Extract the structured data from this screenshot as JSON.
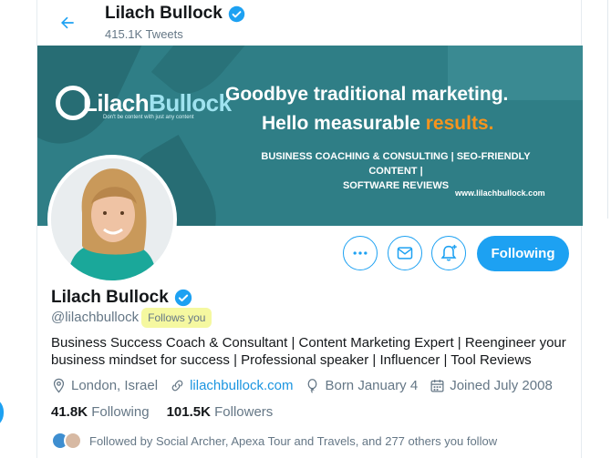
{
  "header": {
    "title": "Lilach Bullock",
    "subtitle": "415.1K Tweets"
  },
  "banner": {
    "logo_part1": "Lilach",
    "logo_part2": "Bullock",
    "logo_tagline": "Don't be content with just any content",
    "headline_line1": "Goodbye traditional marketing.",
    "headline_line2_prefix": "Hello measurable ",
    "headline_line2_accent": "results.",
    "services_line1": "BUSINESS COACHING & CONSULTING | SEO-FRIENDLY CONTENT |",
    "services_line2": "SOFTWARE REVIEWS",
    "url": "www.lilachbullock.com"
  },
  "actions": {
    "following_label": "Following"
  },
  "profile": {
    "name": "Lilach Bullock",
    "handle": "@lilachbullock",
    "follows_you": "Follows you",
    "bio_line1": "Business Success Coach & Consultant | Content Marketing Expert | Reengineer your",
    "bio_line2": "business mindset for success | Professional speaker | Influencer | Tool Reviews",
    "location": "London, Israel",
    "website": "lilachbullock.com",
    "born": "Born January 4",
    "joined": "Joined July 2008",
    "following_count": "41.8K",
    "following_label": "Following",
    "followers_count": "101.5K",
    "followers_label": "Followers",
    "followed_by": "Followed by Social Archer, Apexa Tour and Travels, and 277 others you follow"
  },
  "colors": {
    "accent": "#1da1f2",
    "banner": "#2f7e86",
    "highlight": "#f5f8a0",
    "results_orange": "#f7941d"
  }
}
